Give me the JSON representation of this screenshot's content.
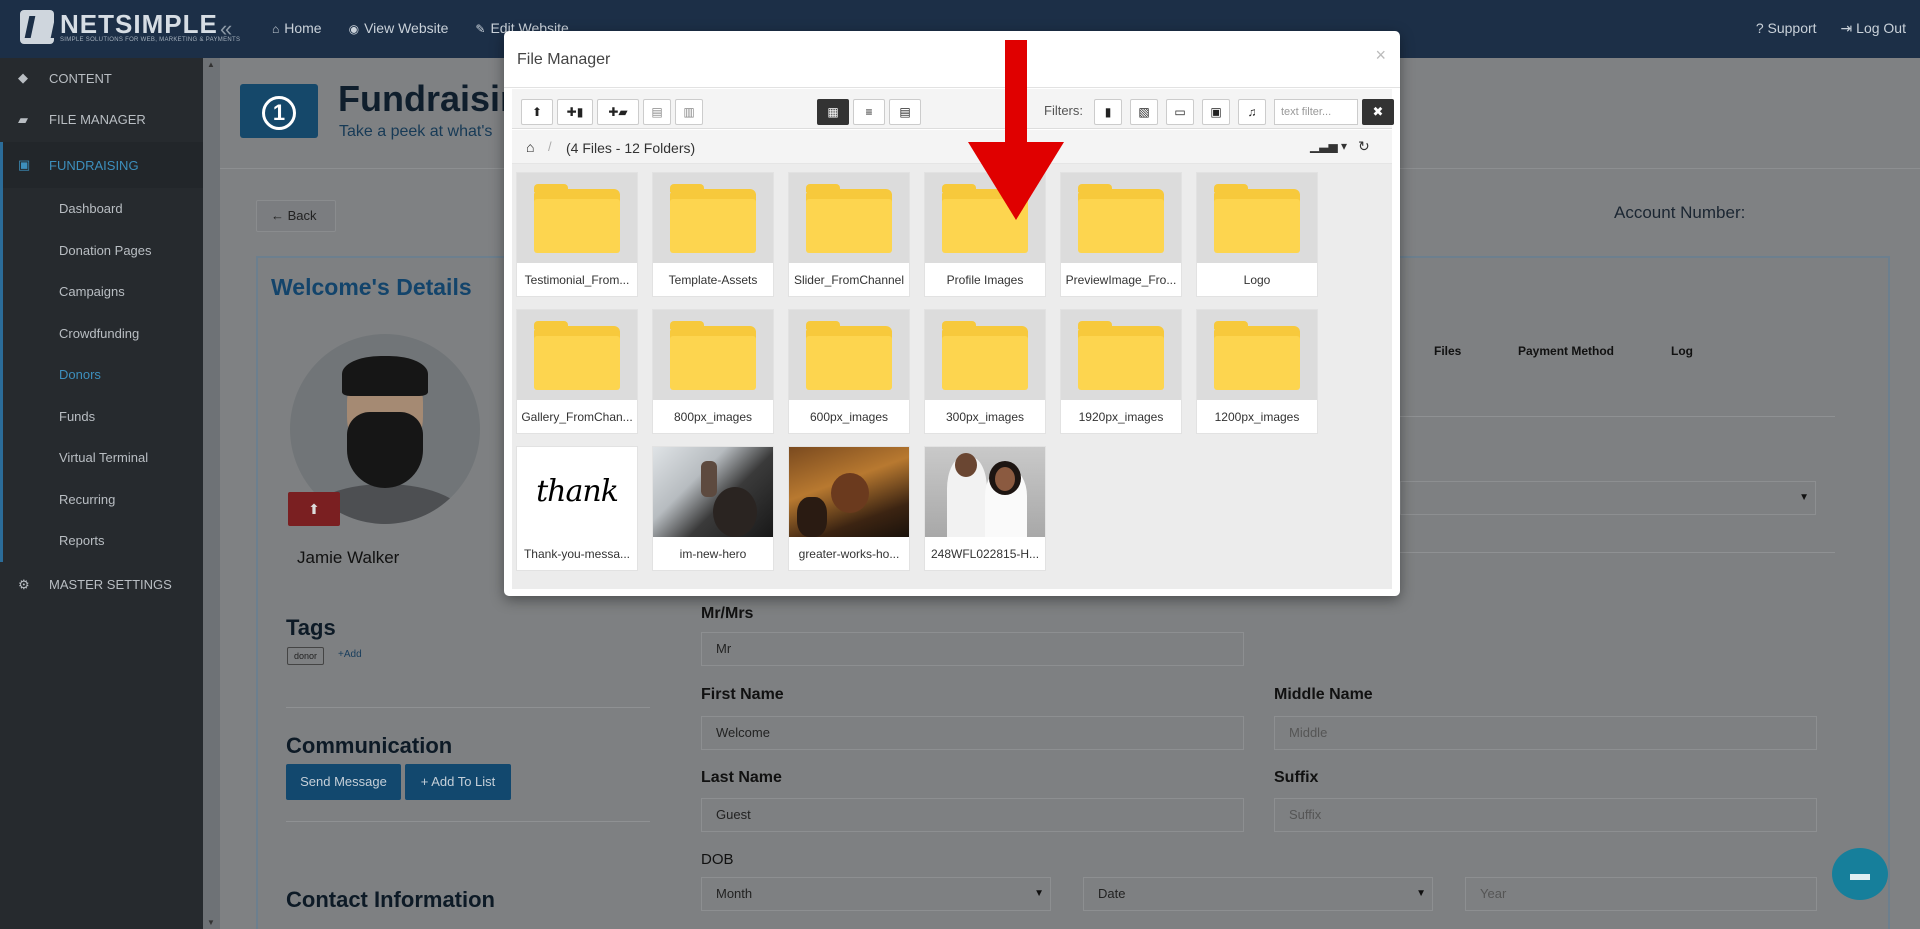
{
  "topbar": {
    "brand_name": "NETSIMPLE",
    "brand_tagline": "SIMPLE SOLUTIONS FOR WEB, MARKETING & PAYMENTS",
    "nav": [
      {
        "label": "Home",
        "icon": "home-icon"
      },
      {
        "label": "View Website",
        "icon": "eye-icon"
      },
      {
        "label": "Edit Website",
        "icon": "edit-icon"
      }
    ],
    "support": "Support",
    "logout": "Log Out"
  },
  "sidebar": {
    "items": [
      {
        "label": "CONTENT",
        "icon": "diamond-icon"
      },
      {
        "label": "FILE MANAGER",
        "icon": "folder-open-icon"
      },
      {
        "label": "FUNDRAISING",
        "icon": "money-icon"
      }
    ],
    "sub_items": [
      "Dashboard",
      "Donation Pages",
      "Campaigns",
      "Crowdfunding",
      "Donors",
      "Funds",
      "Virtual Terminal",
      "Recurring",
      "Reports"
    ],
    "active_sub": "Donors",
    "master": {
      "label": "MASTER SETTINGS",
      "icon": "gear-icon"
    }
  },
  "page": {
    "title": "Fundraising",
    "subtitle": "Take a peek at what's",
    "back": "Back",
    "account_label": "Account Number:",
    "details_title": "Welcome's Details",
    "person_name": "Jamie Walker",
    "tags_title": "Tags",
    "tag_chip": "donor",
    "tag_add": "+Add",
    "communication_title": "Communication",
    "send_message": "Send Message",
    "add_to_list": "+ Add To List",
    "contact_title": "Contact Information",
    "tabs": [
      "Files",
      "Payment Method",
      "Log"
    ],
    "form": {
      "prefix_label": "Mr/Mrs",
      "prefix_value": "Mr",
      "first_name_label": "First Name",
      "first_name_value": "Welcome",
      "middle_name_label": "Middle Name",
      "middle_name_placeholder": "Middle",
      "last_name_label": "Last Name",
      "last_name_value": "Guest",
      "suffix_label": "Suffix",
      "suffix_placeholder": "Suffix",
      "dob_label": "DOB",
      "dob_month": "Month",
      "dob_date": "Date",
      "dob_year_placeholder": "Year"
    }
  },
  "file_manager": {
    "title": "File Manager",
    "close": "×",
    "filters_label": "Filters:",
    "text_filter_placeholder": "text filter...",
    "clear": "✖",
    "count": "(4 Files - 12 Folders)",
    "folders": [
      "Testimonial_From...",
      "Template-Assets",
      "Slider_FromChannel",
      "Profile Images",
      "PreviewImage_Fro...",
      "Logo",
      "Gallery_FromChan...",
      "800px_images",
      "600px_images",
      "300px_images",
      "1920px_images",
      "1200px_images"
    ],
    "files": [
      "Thank-you-messa...",
      "im-new-hero",
      "greater-works-ho...",
      "248WFL022815-H..."
    ],
    "thank_you_image_text": "thank you"
  },
  "colors": {
    "topbar": "#1c2f47",
    "accent": "#3d8fbd",
    "folder": "#fdd54f",
    "arrow": "#e00000"
  }
}
